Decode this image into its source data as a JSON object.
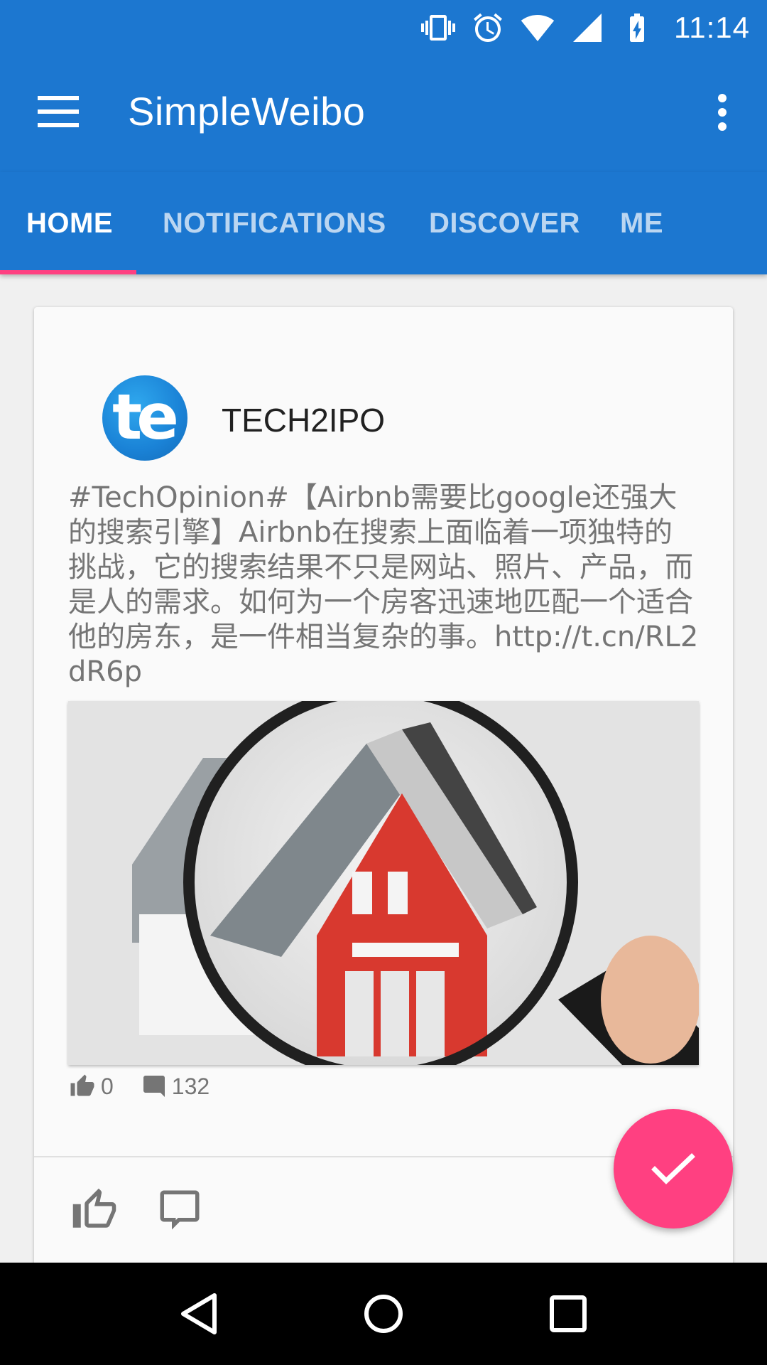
{
  "status_bar": {
    "time": "11:14",
    "icons": [
      "vibrate-icon",
      "alarm-icon",
      "wifi-icon",
      "signal-icon",
      "battery-charging-icon"
    ]
  },
  "app_bar": {
    "title": "SimpleWeibo",
    "menu_icon": "menu-icon",
    "overflow_icon": "more-vert-icon"
  },
  "tabs": [
    {
      "label": "HOME",
      "active": true
    },
    {
      "label": "NOTIFICATIONS",
      "active": false
    },
    {
      "label": "DISCOVER",
      "active": false
    },
    {
      "label": "ME",
      "active": false
    }
  ],
  "post": {
    "avatar_text": "te",
    "username": "TECH2IPO",
    "text": "#TechOpinion#【Airbnb需要比google还强大的搜索引擎】Airbnb在搜索上面临着一项独特的挑战，它的搜索结果不只是网站、照片、产品，而是人的需求。如何为一个房客迅速地匹配一个适合他的房东，是一件相当复杂的事。http://t.cn/RL2dR6p",
    "likes": "0",
    "comments": "132"
  },
  "colors": {
    "primary": "#1c77d0",
    "accent": "#ff4081"
  }
}
